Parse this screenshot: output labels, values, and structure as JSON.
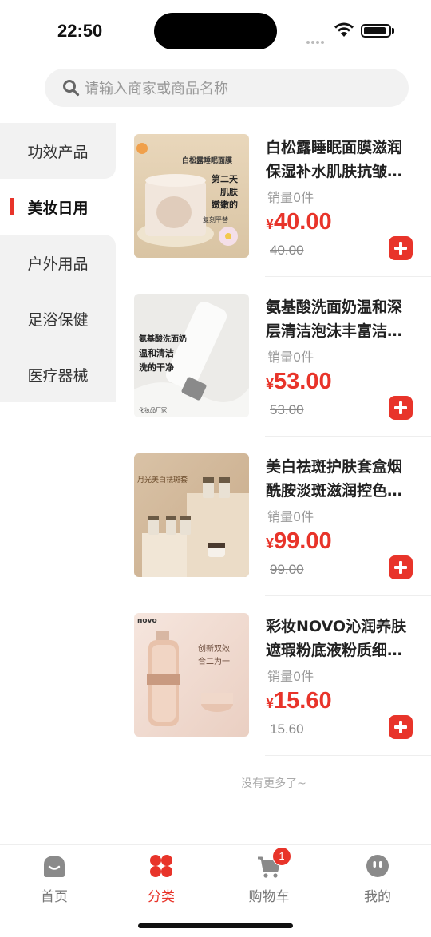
{
  "status_bar": {
    "time": "22:50"
  },
  "search": {
    "placeholder": "请输入商家或商品名称"
  },
  "categories": [
    {
      "label": "功效产品"
    },
    {
      "label": "美妆日用",
      "active": true
    },
    {
      "label": "户外用品"
    },
    {
      "label": "足浴保健"
    },
    {
      "label": "医疗器械"
    }
  ],
  "products": [
    {
      "title": "白松露睡眠面膜滋润保湿补水肌肤抗皱…",
      "sales": "销量0件",
      "currency": "¥",
      "price": "40.00",
      "old_price": "40.00",
      "image_texts": [
        "白松露睡眠面膜",
        "第二天",
        "肌肤",
        "嫩嫩的",
        "复刻平替"
      ]
    },
    {
      "title": "氨基酸洗面奶温和深层清洁泡沫丰富洁…",
      "sales": "销量0件",
      "currency": "¥",
      "price": "53.00",
      "old_price": "53.00",
      "image_texts": [
        "氨基酸洗面奶",
        "温和清洁",
        "洗的干净",
        "化妆品厂家"
      ]
    },
    {
      "title": "美白祛斑护肤套盒烟酰胺淡斑滋润控色…",
      "sales": "销量0件",
      "currency": "¥",
      "price": "99.00",
      "old_price": "99.00",
      "image_texts": [
        "月光美白祛斑套"
      ]
    },
    {
      "title": "彩妆NOVO沁润养肤遮瑕粉底液粉质细…",
      "sales": "销量0件",
      "currency": "¥",
      "price": "15.60",
      "old_price": "15.60",
      "image_texts": [
        "novo",
        "创新双效",
        "合二为一"
      ]
    }
  ],
  "no_more": "没有更多了~",
  "tabbar": {
    "tabs": [
      {
        "label": "首页",
        "icon": "home-icon"
      },
      {
        "label": "分类",
        "icon": "category-icon",
        "active": true
      },
      {
        "label": "购物车",
        "icon": "cart-icon"
      },
      {
        "label": "我的",
        "icon": "profile-icon"
      }
    ],
    "cart_badge": "1"
  },
  "colors": {
    "accent": "#e8342a"
  }
}
